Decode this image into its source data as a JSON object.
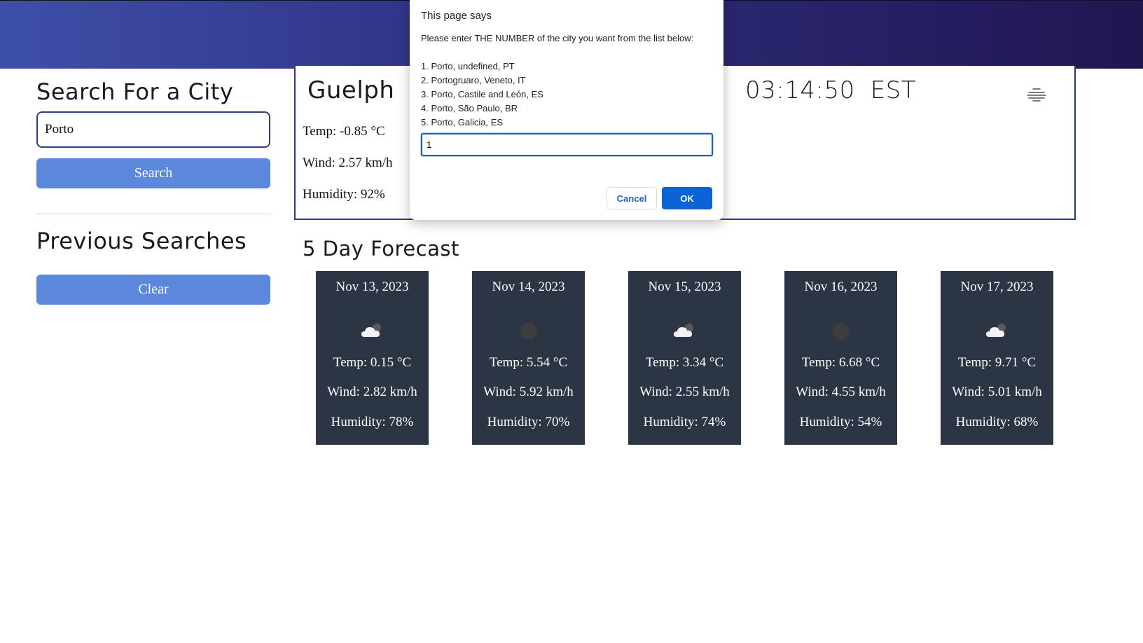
{
  "sidebar": {
    "search_heading": "Search For a City",
    "search_value": "Porto",
    "search_button": "Search",
    "previous_heading": "Previous Searches",
    "clear_button": "Clear"
  },
  "current": {
    "city": "Guelph",
    "temp": "Temp: -0.85 °C",
    "wind": "Wind: 2.57 km/h",
    "humidity": "Humidity: 92%",
    "time": "03:14:50",
    "timezone": "EST",
    "icon": "haze-icon"
  },
  "forecast": {
    "heading": "5 Day Forecast",
    "days": [
      {
        "date": "Nov 13, 2023",
        "icon": "cloud-icon",
        "temp": "Temp: 0.15 °C",
        "wind": "Wind: 2.82 km/h",
        "humidity": "Humidity: 78%"
      },
      {
        "date": "Nov 14, 2023",
        "icon": "moon-icon",
        "temp": "Temp: 5.54 °C",
        "wind": "Wind: 5.92 km/h",
        "humidity": "Humidity: 70%"
      },
      {
        "date": "Nov 15, 2023",
        "icon": "cloud-icon",
        "temp": "Temp: 3.34 °C",
        "wind": "Wind: 2.55 km/h",
        "humidity": "Humidity: 74%"
      },
      {
        "date": "Nov 16, 2023",
        "icon": "moon-icon",
        "temp": "Temp: 6.68 °C",
        "wind": "Wind: 4.55 km/h",
        "humidity": "Humidity: 54%"
      },
      {
        "date": "Nov 17, 2023",
        "icon": "cloud-icon",
        "temp": "Temp: 9.71 °C",
        "wind": "Wind: 5.01 km/h",
        "humidity": "Humidity: 68%"
      }
    ]
  },
  "dialog": {
    "title": "This page says",
    "message": "Please enter THE NUMBER of the city you want from the list below:",
    "options": [
      "1. Porto, undefined, PT",
      "2. Portogruaro, Veneto, IT",
      "3. Porto, Castile and León, ES",
      "4. Porto, São Paulo, BR",
      "5. Porto, Galicia, ES"
    ],
    "input_value": "1",
    "cancel_label": "Cancel",
    "ok_label": "OK"
  },
  "colors": {
    "header_gradient_start": "#3e4fa8",
    "header_gradient_end": "#201650",
    "button_blue": "#5b87dd",
    "card_bg": "#2b3544",
    "dialog_ok": "#0b63d6"
  }
}
